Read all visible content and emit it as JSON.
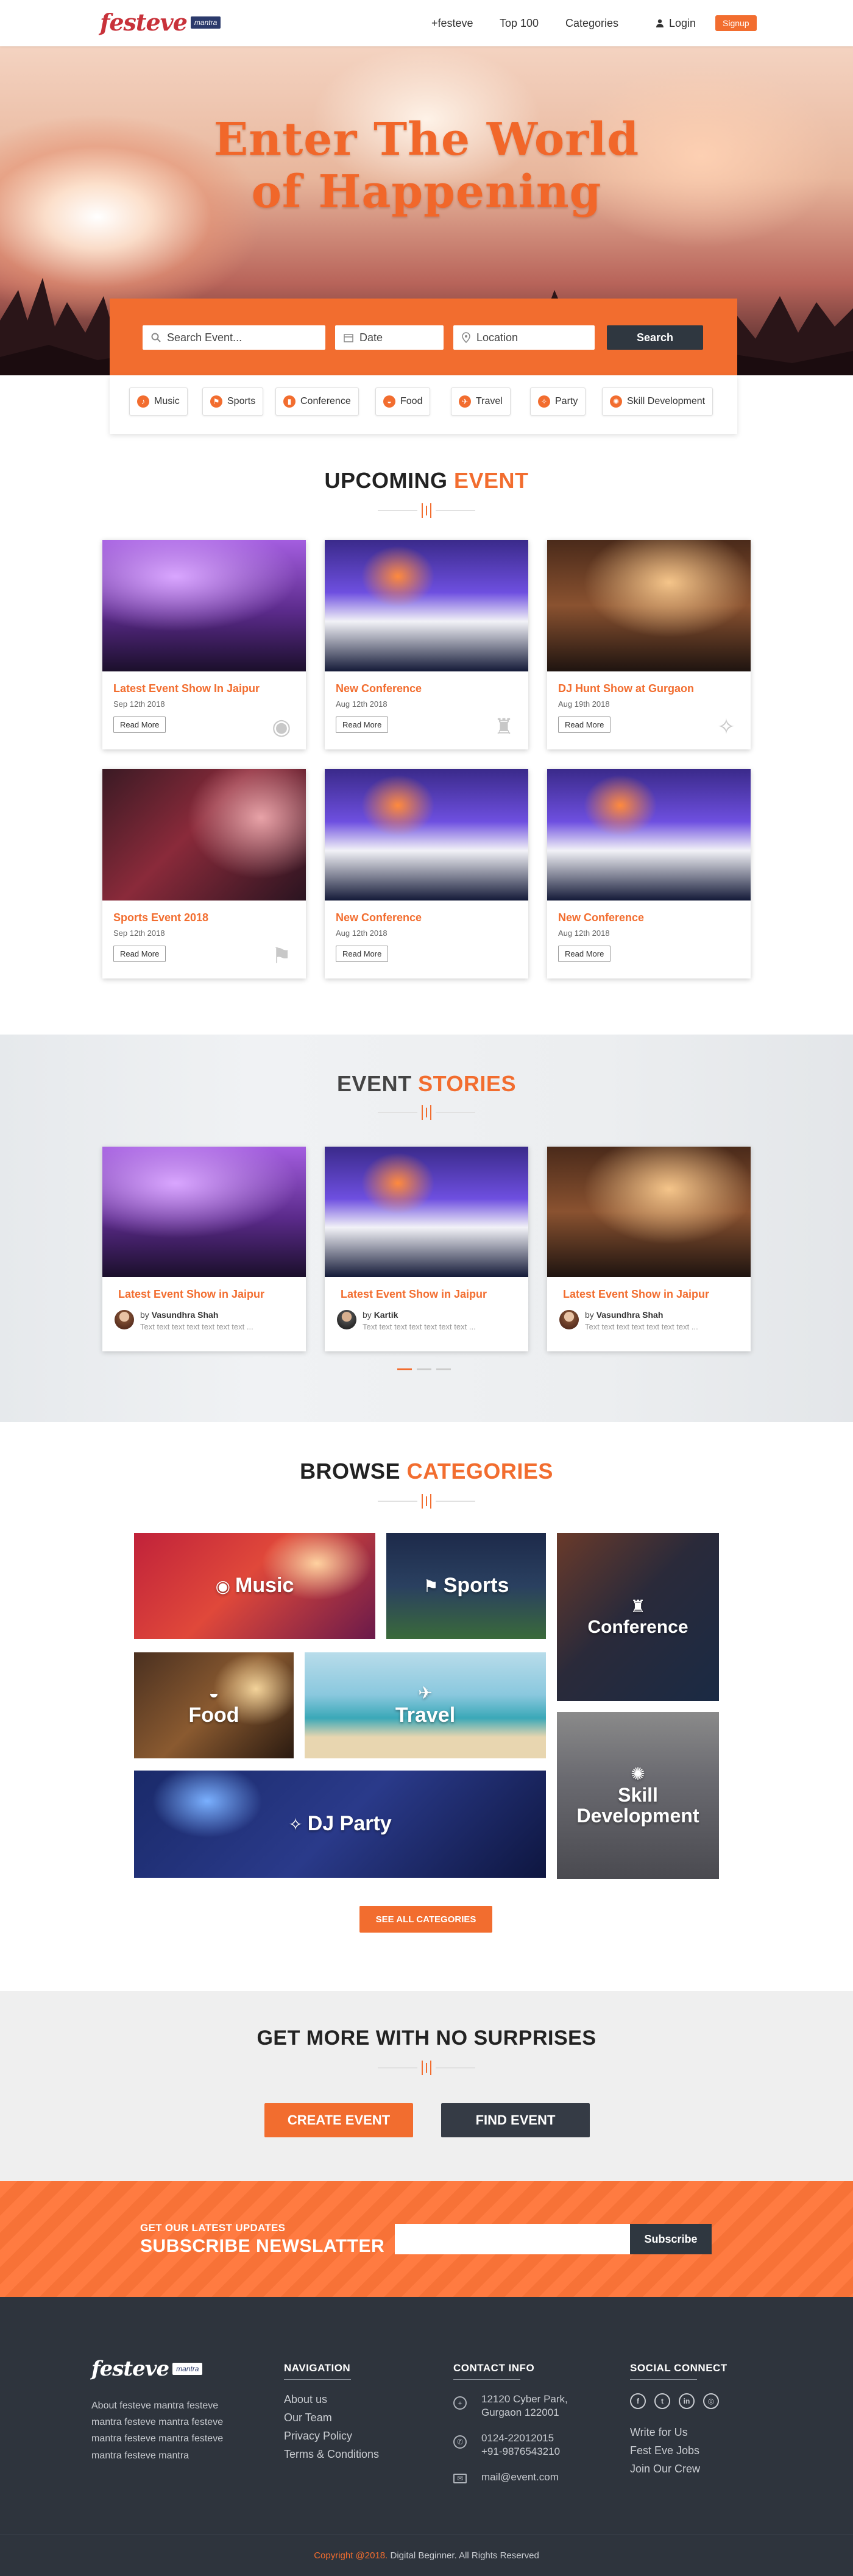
{
  "header": {
    "brand": "festeve",
    "brand_badge": "mantra",
    "nav": [
      "+festeve",
      "Top 100",
      "Categories"
    ],
    "login": "Login",
    "signup": "Signup"
  },
  "hero": {
    "title_line1": "Enter The World",
    "title_line2": "of Happening"
  },
  "search": {
    "event_placeholder": "Search Event...",
    "date_placeholder": "Date",
    "location_placeholder": "Location",
    "button": "Search"
  },
  "quick_categories": [
    "Music",
    "Sports",
    "Conference",
    "Food",
    "Travel",
    "Party",
    "Skill Development"
  ],
  "upcoming": {
    "title": "UPCOMING",
    "title_accent": "EVENT",
    "read_more": "Read More",
    "events": [
      {
        "title": "Latest Event Show In Jaipur",
        "date": "Sep 12th 2018",
        "icon": "music-icon"
      },
      {
        "title": "New Conference",
        "date": "Aug 12th 2018",
        "icon": "podium-icon"
      },
      {
        "title": "DJ Hunt Show at Gurgaon",
        "date": "Aug 19th 2018",
        "icon": "cheers-icon"
      },
      {
        "title": "Sports Event 2018",
        "date": "Sep 12th 2018",
        "icon": "runner-icon"
      },
      {
        "title": "New Conference",
        "date": "Aug 12th 2018",
        "icon": ""
      },
      {
        "title": "New Conference",
        "date": "Aug 12th 2018",
        "icon": ""
      }
    ]
  },
  "stories": {
    "title": "EVENT",
    "title_accent": "STORIES",
    "items": [
      {
        "title": "Latest Event Show in Jaipur",
        "by": "by",
        "author": "Vasundhra Shah",
        "text": "Text text text text text  text text ..."
      },
      {
        "title": "Latest Event Show in Jaipur",
        "by": "by",
        "author": "Kartik",
        "text": "Text text text text text  text text ..."
      },
      {
        "title": "Latest Event Show in Jaipur",
        "by": "by",
        "author": "Vasundhra Shah",
        "text": "Text text text text text  text text ..."
      }
    ]
  },
  "categories": {
    "title": "BROWSE",
    "title_accent": "CATEGORIES",
    "tiles": [
      "Music",
      "Sports",
      "Conference",
      "Food",
      "Travel",
      "DJ Party",
      "Skill Development"
    ],
    "see_all": "SEE ALL CATEGORIES"
  },
  "cta": {
    "title": "GET MORE WITH NO SURPRISES",
    "create": "CREATE EVENT",
    "find": "FIND EVENT"
  },
  "newsletter": {
    "kicker": "GET OUR LATEST UPDATES",
    "title": "SUBSCRIBE NEWSLATTER",
    "button": "Subscribe"
  },
  "footer": {
    "about": "About festeve mantra festeve mantra  festeve mantra festeve mantra festeve mantra festeve mantra festeve mantra",
    "nav_title": "NAVIGATION",
    "nav_links": [
      "About us",
      "Our Team",
      "Privacy Policy",
      "Terms & Conditions"
    ],
    "contact_title": "CONTACT INFO",
    "address_line1": "12120 Cyber Park,",
    "address_line2": "Gurgaon 122001",
    "phone1": "0124-22012015",
    "phone2": "+91-9876543210",
    "email": "mail@event.com",
    "social_title": "SOCIAL CONNECT",
    "social_links": [
      "Write for Us",
      "Fest Eve Jobs",
      "Join Our Crew"
    ],
    "social_icons": [
      "facebook-icon",
      "twitter-icon",
      "linkedin-icon",
      "instagram-icon"
    ],
    "copyright": "Copyright @2018.",
    "copyright_rest": " Digital Beginner. All Rights Reserved"
  },
  "colors": {
    "accent": "#f26d2f",
    "dark": "#2f3740",
    "footer_bg": "#2e343d",
    "brand_red": "#c8323a"
  }
}
